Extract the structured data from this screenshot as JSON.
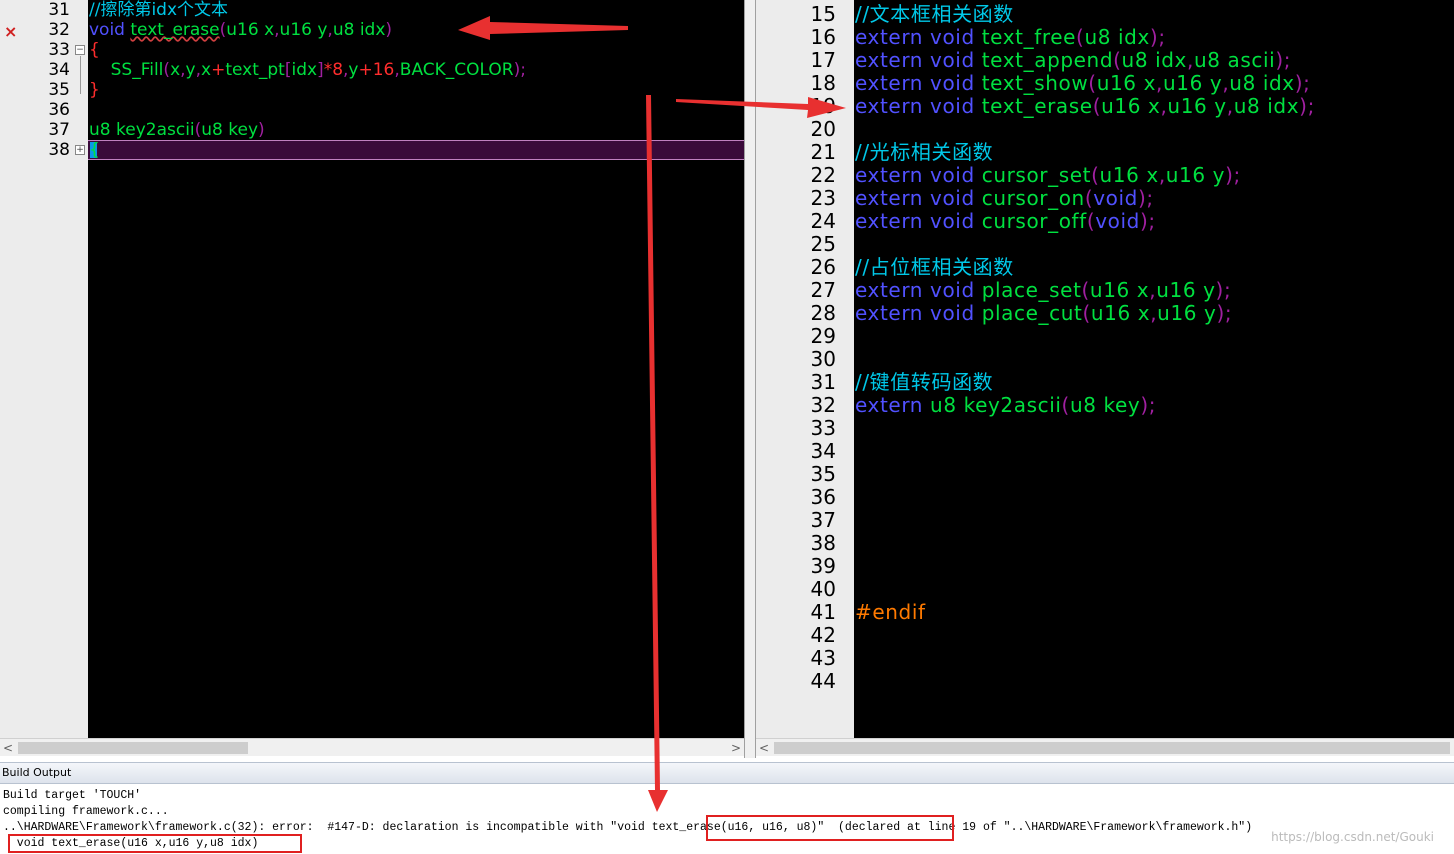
{
  "left_editor": {
    "line_numbers": [
      "31",
      "32",
      "33",
      "34",
      "35",
      "36",
      "37",
      "38"
    ],
    "error_marker": "×",
    "lines": [
      [
        {
          "t": "//擦除第idx个文本",
          "c": "cm"
        }
      ],
      [
        {
          "t": "void ",
          "c": "kw"
        },
        {
          "t": "text_erase",
          "c": "ty squig"
        },
        {
          "t": "(",
          "c": "pu"
        },
        {
          "t": "u16 x",
          "c": "ty"
        },
        {
          "t": ",",
          "c": "pu"
        },
        {
          "t": "u16 y",
          "c": "ty"
        },
        {
          "t": ",",
          "c": "pu"
        },
        {
          "t": "u8 idx",
          "c": "ty"
        },
        {
          "t": ")",
          "c": "pu"
        }
      ],
      [
        {
          "t": "{",
          "c": "nm"
        }
      ],
      [
        {
          "t": "    SS_Fill",
          "c": "ty"
        },
        {
          "t": "(",
          "c": "pu"
        },
        {
          "t": "x",
          "c": "ty"
        },
        {
          "t": ",",
          "c": "pu"
        },
        {
          "t": "y",
          "c": "ty"
        },
        {
          "t": ",",
          "c": "pu"
        },
        {
          "t": "x",
          "c": "ty"
        },
        {
          "t": "+",
          "c": "nm"
        },
        {
          "t": "text_pt",
          "c": "ty"
        },
        {
          "t": "[",
          "c": "pu"
        },
        {
          "t": "idx",
          "c": "ty"
        },
        {
          "t": "]",
          "c": "pu"
        },
        {
          "t": "*8",
          "c": "nm"
        },
        {
          "t": ",",
          "c": "pu"
        },
        {
          "t": "y",
          "c": "ty"
        },
        {
          "t": "+16",
          "c": "nm"
        },
        {
          "t": ",",
          "c": "pu"
        },
        {
          "t": "BACK_COLOR",
          "c": "ty"
        },
        {
          "t": ")",
          "c": "pu"
        },
        {
          "t": ";",
          "c": "pu"
        }
      ],
      [
        {
          "t": "}",
          "c": "nm"
        }
      ],
      [],
      [
        {
          "t": "u8 key2ascii",
          "c": "ty"
        },
        {
          "t": "(",
          "c": "pu"
        },
        {
          "t": "u8 key",
          "c": "ty"
        },
        {
          "t": ")",
          "c": "pu"
        }
      ],
      [
        {
          "t": "{",
          "c": "ty"
        }
      ]
    ]
  },
  "right_editor": {
    "line_numbers": [
      "15",
      "16",
      "17",
      "18",
      "19",
      "20",
      "21",
      "22",
      "23",
      "24",
      "25",
      "26",
      "27",
      "28",
      "29",
      "30",
      "31",
      "32",
      "33",
      "34",
      "35",
      "36",
      "37",
      "38",
      "39",
      "40",
      "41",
      "42",
      "43",
      "44"
    ],
    "lines": [
      [
        {
          "t": "//文本框相关函数",
          "c": "cm"
        }
      ],
      [
        {
          "t": "extern void ",
          "c": "kw"
        },
        {
          "t": "text_free",
          "c": "ty"
        },
        {
          "t": "(",
          "c": "pu"
        },
        {
          "t": "u8 idx",
          "c": "ty"
        },
        {
          "t": ")",
          "c": "pu"
        },
        {
          "t": ";",
          "c": "pu"
        }
      ],
      [
        {
          "t": "extern void ",
          "c": "kw"
        },
        {
          "t": "text_append",
          "c": "ty"
        },
        {
          "t": "(",
          "c": "pu"
        },
        {
          "t": "u8 idx",
          "c": "ty"
        },
        {
          "t": ",",
          "c": "pu"
        },
        {
          "t": "u8 ascii",
          "c": "ty"
        },
        {
          "t": ")",
          "c": "pu"
        },
        {
          "t": ";",
          "c": "pu"
        }
      ],
      [
        {
          "t": "extern void ",
          "c": "kw"
        },
        {
          "t": "text_show",
          "c": "ty"
        },
        {
          "t": "(",
          "c": "pu"
        },
        {
          "t": "u16 x",
          "c": "ty"
        },
        {
          "t": ",",
          "c": "pu"
        },
        {
          "t": "u16 y",
          "c": "ty"
        },
        {
          "t": ",",
          "c": "pu"
        },
        {
          "t": "u8 idx",
          "c": "ty"
        },
        {
          "t": ")",
          "c": "pu"
        },
        {
          "t": ";",
          "c": "pu"
        }
      ],
      [
        {
          "t": "extern void ",
          "c": "kw"
        },
        {
          "t": "text_erase",
          "c": "ty"
        },
        {
          "t": "(",
          "c": "pu"
        },
        {
          "t": "u16 x",
          "c": "ty"
        },
        {
          "t": ",",
          "c": "pu"
        },
        {
          "t": "u16 y",
          "c": "ty"
        },
        {
          "t": ",",
          "c": "pu"
        },
        {
          "t": "u8 idx",
          "c": "ty"
        },
        {
          "t": ")",
          "c": "pu"
        },
        {
          "t": ";",
          "c": "pu"
        }
      ],
      [],
      [
        {
          "t": "//光标相关函数",
          "c": "cm"
        }
      ],
      [
        {
          "t": "extern void ",
          "c": "kw"
        },
        {
          "t": "cursor_set",
          "c": "ty"
        },
        {
          "t": "(",
          "c": "pu"
        },
        {
          "t": "u16 x",
          "c": "ty"
        },
        {
          "t": ",",
          "c": "pu"
        },
        {
          "t": "u16 y",
          "c": "ty"
        },
        {
          "t": ")",
          "c": "pu"
        },
        {
          "t": ";",
          "c": "pu"
        }
      ],
      [
        {
          "t": "extern void ",
          "c": "kw"
        },
        {
          "t": "cursor_on",
          "c": "ty"
        },
        {
          "t": "(",
          "c": "pu"
        },
        {
          "t": "void",
          "c": "kw"
        },
        {
          "t": ")",
          "c": "pu"
        },
        {
          "t": ";",
          "c": "pu"
        }
      ],
      [
        {
          "t": "extern void ",
          "c": "kw"
        },
        {
          "t": "cursor_off",
          "c": "ty"
        },
        {
          "t": "(",
          "c": "pu"
        },
        {
          "t": "void",
          "c": "kw"
        },
        {
          "t": ")",
          "c": "pu"
        },
        {
          "t": ";",
          "c": "pu"
        }
      ],
      [],
      [
        {
          "t": "//占位框相关函数",
          "c": "cm"
        }
      ],
      [
        {
          "t": "extern void ",
          "c": "kw"
        },
        {
          "t": "place_set",
          "c": "ty"
        },
        {
          "t": "(",
          "c": "pu"
        },
        {
          "t": "u16 x",
          "c": "ty"
        },
        {
          "t": ",",
          "c": "pu"
        },
        {
          "t": "u16 y",
          "c": "ty"
        },
        {
          "t": ")",
          "c": "pu"
        },
        {
          "t": ";",
          "c": "pu"
        }
      ],
      [
        {
          "t": "extern void ",
          "c": "kw"
        },
        {
          "t": "place_cut",
          "c": "ty"
        },
        {
          "t": "(",
          "c": "pu"
        },
        {
          "t": "u16 x",
          "c": "ty"
        },
        {
          "t": ",",
          "c": "pu"
        },
        {
          "t": "u16 y",
          "c": "ty"
        },
        {
          "t": ")",
          "c": "pu"
        },
        {
          "t": ";",
          "c": "pu"
        }
      ],
      [],
      [],
      [
        {
          "t": "//键值转码函数",
          "c": "cm"
        }
      ],
      [
        {
          "t": "extern ",
          "c": "kw"
        },
        {
          "t": "u8 key2ascii",
          "c": "ty"
        },
        {
          "t": "(",
          "c": "pu"
        },
        {
          "t": "u8 key",
          "c": "ty"
        },
        {
          "t": ")",
          "c": "pu"
        },
        {
          "t": ";",
          "c": "pu"
        }
      ],
      [],
      [],
      [],
      [],
      [],
      [],
      [],
      [],
      [
        {
          "t": "#endif",
          "c": "pp"
        }
      ],
      [],
      [],
      []
    ]
  },
  "build_output": {
    "title": "Build Output",
    "lines": [
      "Build target 'TOUCH'",
      "compiling framework.c...",
      "..\\HARDWARE\\Framework\\framework.c(32): error:  #147-D: declaration is incompatible with \"void text_erase(u16, u16, u8)\"  (declared at line 19 of \"..\\HARDWARE\\Framework\\framework.h\")",
      "  void text_erase(u16 x,u16 y,u8 idx)"
    ],
    "watermark": "https://blog.csdn.net/Gouki"
  }
}
